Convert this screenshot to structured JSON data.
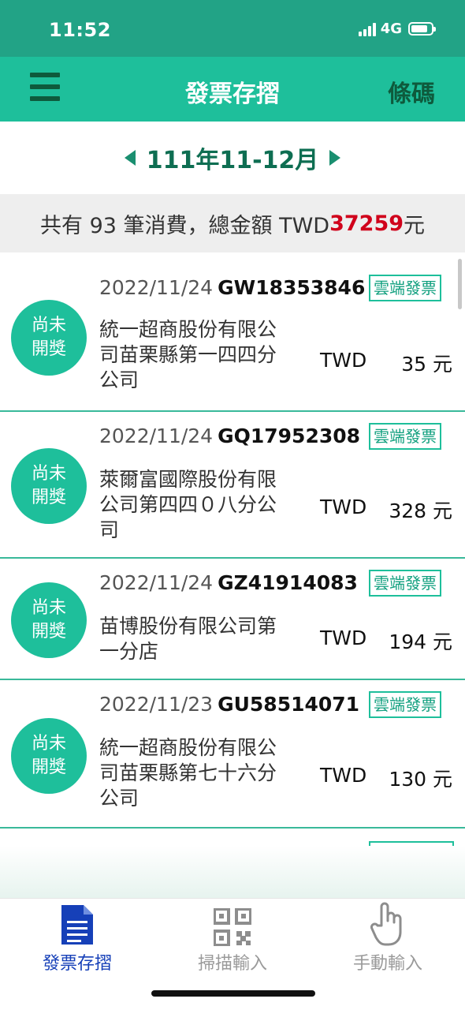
{
  "status_bar": {
    "time": "11:52",
    "network": "4G"
  },
  "header": {
    "title": "發票存摺",
    "barcode_label": "條碼"
  },
  "period": {
    "label": "111年11-12月"
  },
  "summary": {
    "prefix": "共有 93 筆消費，總金額 TWD",
    "amount": "37259",
    "suffix": "元"
  },
  "invoices": [
    {
      "status_line1": "尚未",
      "status_line2": "開獎",
      "date": "2022/11/24",
      "number": "GW18353846",
      "badge": "雲端發票",
      "merchant_lines": [
        "統一超商股份有限公",
        "司苗栗縣第一四四分",
        "公司"
      ],
      "currency": "TWD",
      "amount": "35 元"
    },
    {
      "status_line1": "尚未",
      "status_line2": "開獎",
      "date": "2022/11/24",
      "number": "GQ17952308",
      "badge": "雲端發票",
      "merchant_lines": [
        "萊爾富國際股份有限",
        "公司第四四０八分公",
        "司"
      ],
      "currency": "TWD",
      "amount": "328 元"
    },
    {
      "status_line1": "尚未",
      "status_line2": "開獎",
      "date": "2022/11/24",
      "number": "GZ41914083",
      "badge": "雲端發票",
      "merchant_lines": [
        "苗博股份有限公司第",
        "一分店"
      ],
      "currency": "TWD",
      "amount": "194 元"
    },
    {
      "status_line1": "尚未",
      "status_line2": "開獎",
      "date": "2022/11/23",
      "number": "GU58514071",
      "badge": "雲端發票",
      "merchant_lines": [
        "統一超商股份有限公",
        "司苗栗縣第七十六分",
        "公司"
      ],
      "currency": "TWD",
      "amount": "130 元"
    }
  ],
  "tabs": [
    {
      "label": "發票存摺",
      "icon": "document-icon",
      "active": true
    },
    {
      "label": "掃描輸入",
      "icon": "qr-code-icon",
      "active": false
    },
    {
      "label": "手動輸入",
      "icon": "hand-pointer-icon",
      "active": false
    }
  ],
  "colors": {
    "header": "#1ebf9b",
    "status_bar": "#22a386",
    "amount_red": "#d0021b",
    "active_tab": "#1640b8"
  }
}
